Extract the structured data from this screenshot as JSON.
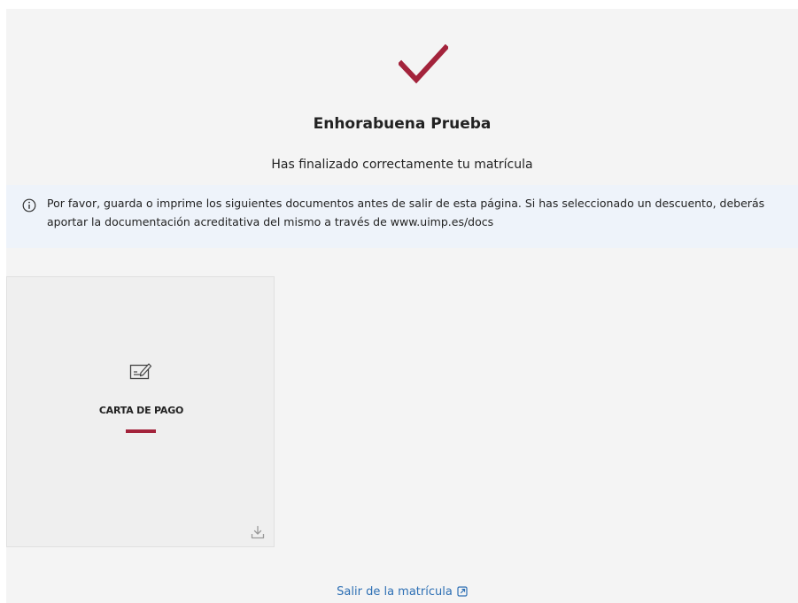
{
  "success": {
    "icon": "checkmark-icon",
    "title": "Enhorabuena Prueba",
    "subtitle": "Has finalizado correctamente tu matrícula"
  },
  "notice": {
    "icon": "info-circle-icon",
    "text": "Por favor, guarda o imprime los siguientes documentos antes de salir de esta página. Si has seleccionado un descuento, deberás aportar la documentación acreditativa del mismo a través de www.uimp.es/docs"
  },
  "documents": [
    {
      "label": "CARTA DE PAGO",
      "icon": "payment-document-icon",
      "action_icon": "download-icon"
    }
  ],
  "footer": {
    "exit_label": "Salir de la matrícula",
    "exit_icon": "external-link-icon"
  },
  "colors": {
    "accent": "#a3233b",
    "link": "#2d6fb4",
    "background": "#f4f4f4",
    "notice_background": "#eef3fa"
  }
}
